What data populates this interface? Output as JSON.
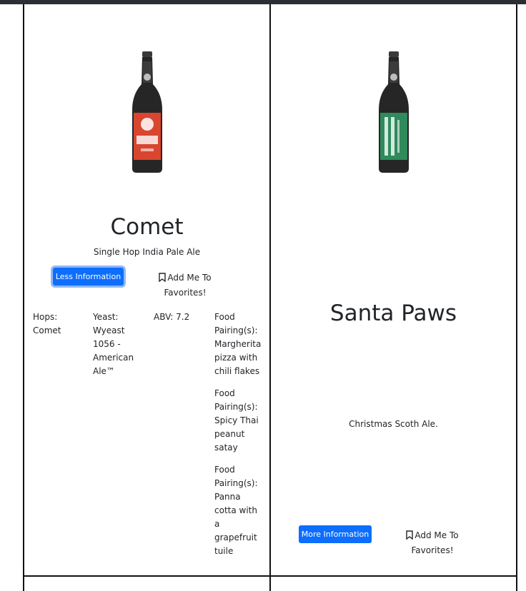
{
  "cards": [
    {
      "name": "Comet",
      "tagline": "Single Hop India Pale Ale",
      "info_button": "Less Information",
      "favorite_label": "Add Me To Favorites!",
      "label_color": "#d9452f",
      "hops": "Hops: Comet",
      "yeast": "Yeast: Wyeast 1056 - American Ale™",
      "abv": "ABV: 7.2",
      "food_pairings": [
        "Food Pairing(s): Margherita pizza with chili flakes",
        "Food Pairing(s): Spicy Thai peanut satay",
        "Food Pairing(s): Panna cotta with a grapefruit tuile"
      ]
    },
    {
      "name": "Santa Paws",
      "tagline": "Christmas Scoth Ale.",
      "info_button": "More Information",
      "favorite_label": "Add Me To Favorites!",
      "label_color": "#2f8a5c"
    }
  ],
  "colors": {
    "primary": "#0d6efd",
    "text": "#212529"
  },
  "icons": {
    "favorite": "bookmark-icon"
  }
}
